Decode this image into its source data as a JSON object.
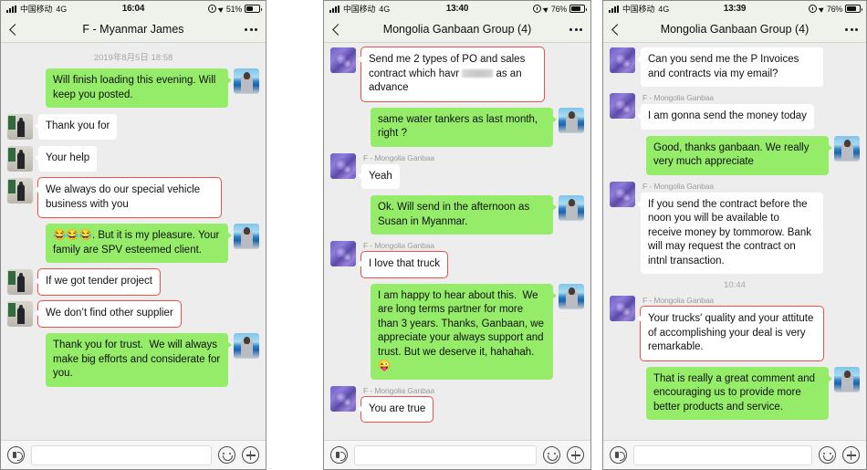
{
  "panels": [
    {
      "status": {
        "carrier": "中国移动",
        "network": "4G",
        "time": "16:04",
        "battery": "51%"
      },
      "nav": {
        "title": "F - Myanmar James",
        "back_icon": "chevron-left-icon",
        "more_icon": "more-dots-icon"
      },
      "daystamp": "2019年8月5日 18:58",
      "messages": [
        {
          "side": "right",
          "avatar": "av-sea",
          "text": "Will finish loading this evening. Will keep you posted.",
          "highlight": false
        },
        {
          "side": "left",
          "avatar": "av-man",
          "text": "Thank you for",
          "highlight": false
        },
        {
          "side": "left",
          "avatar": "av-man",
          "text": "Your help",
          "highlight": false
        },
        {
          "side": "left",
          "avatar": "av-man",
          "text": "We always do our special vehicle business with you",
          "highlight": true
        },
        {
          "side": "right",
          "avatar": "av-sea",
          "text": "😂😂😂. But it is my pleasure. Your family are SPV esteemed client.",
          "highlight": false
        },
        {
          "side": "left",
          "avatar": "av-man",
          "text": "If we got tender project",
          "highlight": true
        },
        {
          "side": "left",
          "avatar": "av-man",
          "text": "We don’t find other supplier",
          "highlight": true
        },
        {
          "side": "right",
          "avatar": "av-sea",
          "text": "Thank you for trust.  We will always make big efforts and considerate for you.",
          "highlight": false
        }
      ],
      "input": {
        "voice_icon": "voice-icon",
        "placeholder": "",
        "value": "",
        "emoji_icon": "emoji-icon",
        "plus_icon": "plus-icon"
      }
    },
    {
      "status": {
        "carrier": "中国移动",
        "network": "4G",
        "time": "13:40",
        "battery": "76%"
      },
      "nav": {
        "title": "Mongolia Ganbaan Group (4)",
        "back_icon": "chevron-left-icon",
        "more_icon": "more-dots-icon"
      },
      "daystamp": "",
      "messages": [
        {
          "side": "left",
          "avatar": "av-purple",
          "text_pre": "Send me 2 types of PO and sales contract which havr ",
          "redacted": true,
          "text_post": " as an advance",
          "highlight": true
        },
        {
          "side": "right",
          "avatar": "av-sea",
          "text": "same water tankers as last month, right ?",
          "highlight": false
        },
        {
          "side": "left",
          "avatar": "av-purple",
          "sender": "F - Mongolia Ganbaa",
          "text": "Yeah",
          "highlight": false
        },
        {
          "side": "right",
          "avatar": "av-sea",
          "text": "Ok. Will send in the afternoon as Susan in Myanmar.",
          "highlight": false
        },
        {
          "side": "left",
          "avatar": "av-purple",
          "sender": "F - Mongolia Ganbaa",
          "text": "I love that truck",
          "highlight": true
        },
        {
          "side": "right",
          "avatar": "av-sea",
          "text": "I am happy to hear about this.  We are long terms partner for more than 3 years. Thanks, Ganbaan, we appreciate your always support and trust. But we deserve it, hahahah. 😜",
          "highlight": false
        },
        {
          "side": "left",
          "avatar": "av-purple",
          "sender": "F - Mongolia Ganbaa",
          "text": "You are true",
          "highlight": true
        }
      ],
      "input": {
        "voice_icon": "voice-icon",
        "placeholder": "",
        "value": "",
        "emoji_icon": "emoji-icon",
        "plus_icon": "plus-icon"
      }
    },
    {
      "status": {
        "carrier": "中国移动",
        "network": "4G",
        "time": "13:39",
        "battery": "76%"
      },
      "nav": {
        "title": "Mongolia Ganbaan Group (4)",
        "back_icon": "chevron-left-icon",
        "more_icon": "more-dots-icon"
      },
      "daystamp": "",
      "messages": [
        {
          "side": "left",
          "avatar": "av-purple",
          "text": "Can you send me the P Invoices and contracts via my email?",
          "highlight": false
        },
        {
          "side": "left",
          "avatar": "av-purple",
          "sender": "F - Mongolia Ganbaa",
          "text": "I am gonna send the money today",
          "highlight": false
        },
        {
          "side": "right",
          "avatar": "av-sea",
          "text": "Good, thanks ganbaan. We really very much appreciate",
          "highlight": false
        },
        {
          "side": "left",
          "avatar": "av-purple",
          "sender": "F - Mongolia Ganbaa",
          "text": "If you send the contract before the noon you will be available to receive money by tommorow. Bank will may request the contract on intnl transaction.",
          "highlight": false
        },
        {
          "timestamp": "10:44"
        },
        {
          "side": "left",
          "avatar": "av-purple",
          "sender": "F - Mongolia Ganbaa",
          "text": "Your trucks' quality and your attitute of accomplishing your deal is very remarkable.",
          "highlight": true
        },
        {
          "side": "right",
          "avatar": "av-sea",
          "text": "That is really a great comment and encouraging us to provide more better products and service.",
          "highlight": false
        }
      ],
      "input": {
        "voice_icon": "voice-icon",
        "placeholder": "",
        "value": "",
        "emoji_icon": "emoji-icon",
        "plus_icon": "plus-icon"
      }
    }
  ],
  "colors": {
    "outgoing_bubble": "#95ec69",
    "incoming_bubble": "#ffffff",
    "chat_background": "#ededed",
    "highlight_outline": "#e8524a",
    "navbar_background": "#eef2ea"
  }
}
